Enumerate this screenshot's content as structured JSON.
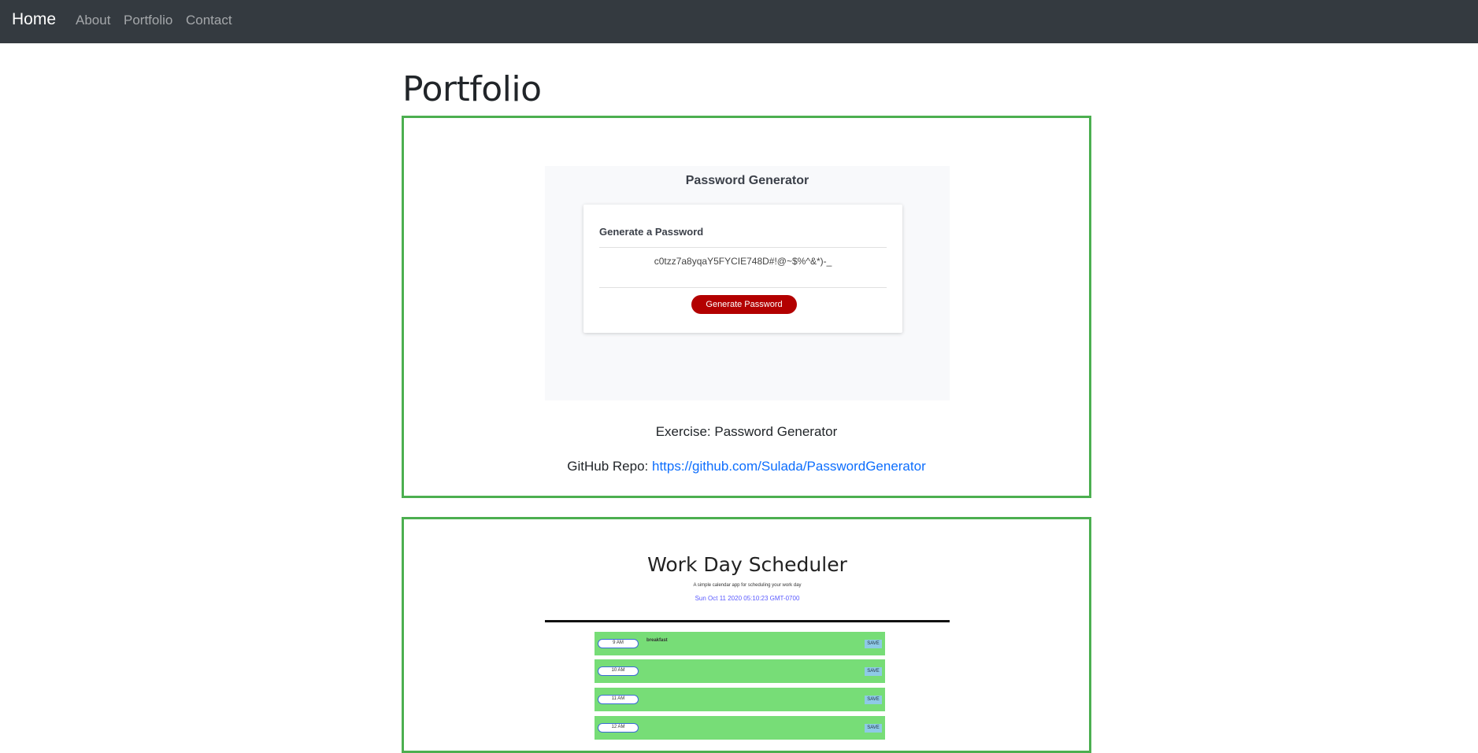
{
  "navbar": {
    "brand": "Home",
    "links": [
      "About",
      "Portfolio",
      "Contact"
    ]
  },
  "page": {
    "title": "Portfolio"
  },
  "projects": [
    {
      "screenshot": {
        "app_title": "Password Generator",
        "panel_heading": "Generate a Password",
        "password": "c0tzz7a8yqaY5FYCIE748D#!@~$%^&*)-_",
        "button_label": "Generate Password"
      },
      "caption": "Exercise: Password Generator",
      "repo_label": "GitHub Repo:",
      "repo_url": "https://github.com/Sulada/PasswordGenerator"
    },
    {
      "screenshot": {
        "app_title": "Work Day Scheduler",
        "subtitle": "A simple calendar app for scheduling your work day",
        "date": "Sun Oct 11 2020 05:10:23 GMT-0700",
        "rows": [
          {
            "hour": "9 AM",
            "event": "breakfast",
            "save": "SAVE"
          },
          {
            "hour": "10 AM",
            "event": "",
            "save": "SAVE"
          },
          {
            "hour": "11 AM",
            "event": "",
            "save": "SAVE"
          },
          {
            "hour": "12 AM",
            "event": "",
            "save": "SAVE"
          }
        ]
      }
    }
  ],
  "colors": {
    "navbar_bg": "#343a40",
    "card_border": "#4caf50",
    "link": "#0d6efd",
    "generate_button": "#b30000",
    "scheduler_row": "#77dd77"
  }
}
